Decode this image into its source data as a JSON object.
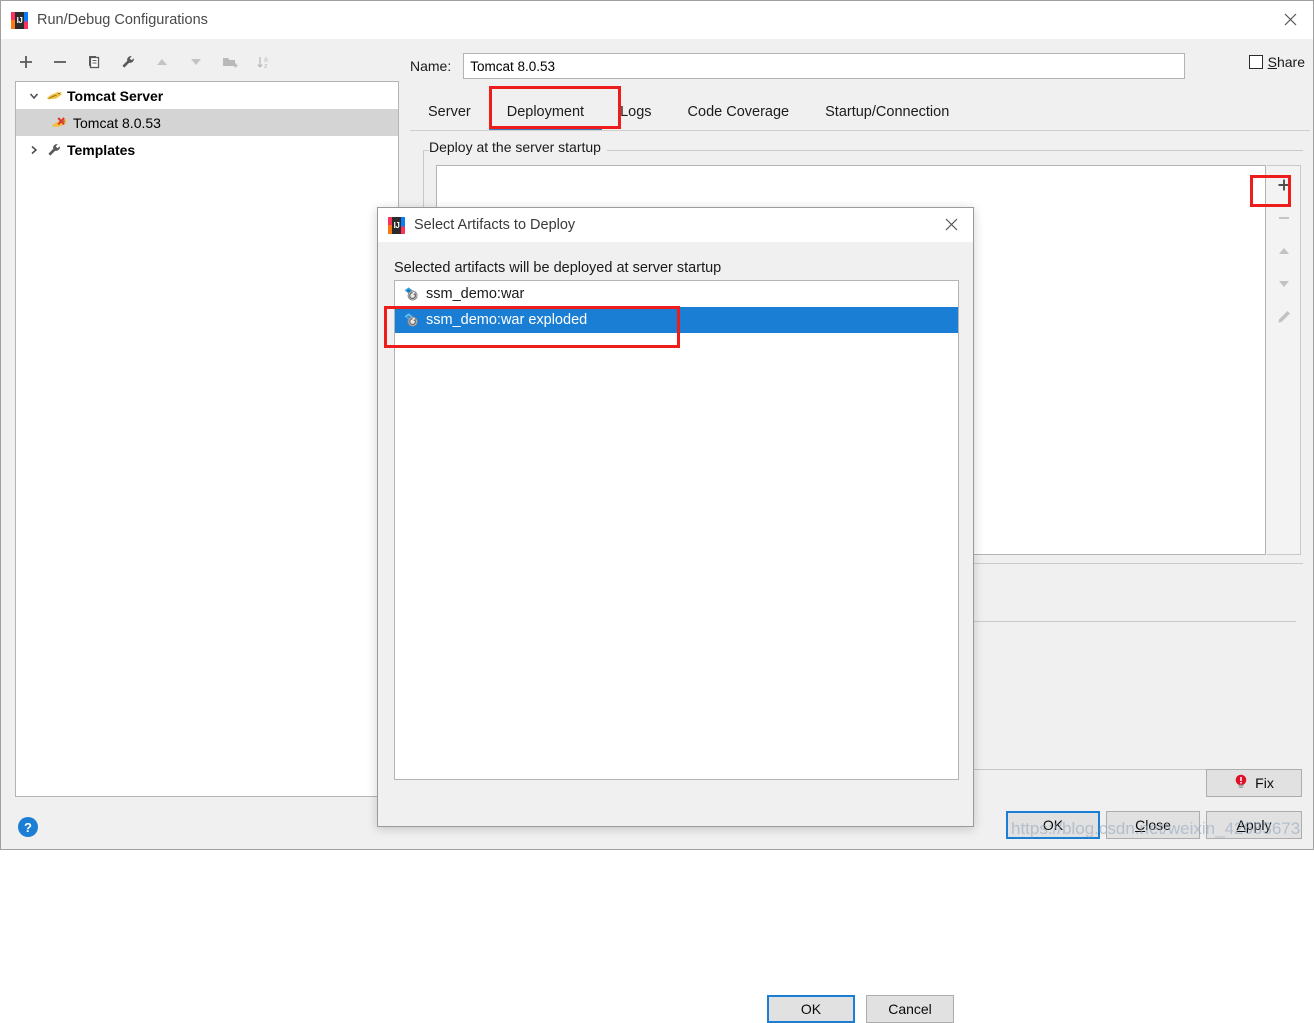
{
  "window": {
    "title": "Run/Debug Configurations",
    "logo_icon": "intellij-idea-logo",
    "logo_text": "IJ",
    "close_icon": "close-icon"
  },
  "toolbar": {
    "buttons": [
      {
        "name": "add-configuration-button",
        "icon": "plus-icon",
        "enabled": true
      },
      {
        "name": "remove-configuration-button",
        "icon": "minus-icon",
        "enabled": true
      },
      {
        "name": "copy-configuration-button",
        "icon": "copy-icon",
        "enabled": true
      },
      {
        "name": "edit-templates-button",
        "icon": "wrench-icon",
        "enabled": true
      },
      {
        "name": "move-up-button",
        "icon": "arrow-up-icon",
        "enabled": false
      },
      {
        "name": "move-down-button",
        "icon": "arrow-down-icon",
        "enabled": false
      },
      {
        "name": "create-folder-button",
        "icon": "folder-add-icon",
        "enabled": false
      },
      {
        "name": "sort-configurations-button",
        "icon": "sort-az-icon",
        "enabled": false
      }
    ]
  },
  "tree": {
    "items": [
      {
        "label": "Tomcat Server",
        "icon": "tomcat-icon",
        "level": 0,
        "expanded": true,
        "arrow": "chevron-down-icon",
        "selected": false,
        "error": false
      },
      {
        "label": "Tomcat 8.0.53",
        "icon": "tomcat-error-icon",
        "level": 1,
        "expanded": null,
        "arrow": "",
        "selected": true,
        "error": true
      },
      {
        "label": "Templates",
        "icon": "wrench-icon",
        "level": 0,
        "expanded": false,
        "arrow": "chevron-right-icon",
        "selected": false,
        "error": false
      }
    ]
  },
  "help": {
    "label": "?",
    "icon": "help-icon"
  },
  "name_field": {
    "label": "Name:",
    "value": "Tomcat 8.0.53",
    "placeholder": "Name"
  },
  "share": {
    "label_prefix": "",
    "label_mnemonic": "S",
    "label_rest": "hare",
    "checked": false
  },
  "tabs": [
    {
      "label": "Server",
      "active": false
    },
    {
      "label": "Deployment",
      "active": true
    },
    {
      "label": "Logs",
      "active": false
    },
    {
      "label": "Code Coverage",
      "active": false
    },
    {
      "label": "Startup/Connection",
      "active": false
    }
  ],
  "deploy_group": {
    "title": "Deploy at the server startup",
    "side_buttons": [
      {
        "name": "add-artifact-button",
        "icon": "plus-icon",
        "enabled": true
      },
      {
        "name": "remove-artifact-button",
        "icon": "minus-icon",
        "enabled": false
      },
      {
        "name": "move-artifact-up-button",
        "icon": "arrow-up-icon",
        "enabled": false
      },
      {
        "name": "move-artifact-down-button",
        "icon": "arrow-down-icon",
        "enabled": false
      },
      {
        "name": "edit-artifact-button",
        "icon": "pencil-icon",
        "enabled": false
      }
    ],
    "rows": []
  },
  "bottom_buttons": {
    "fix": {
      "label": "Fix",
      "icon": "error-bulb-icon"
    },
    "ok": {
      "label": "OK",
      "focused": true
    },
    "close": {
      "label_prefix": "",
      "label_mnemonic": "C",
      "label_rest": "lose"
    },
    "apply": {
      "label_prefix": "",
      "label_mnemonic": "A",
      "label_rest": "pply"
    }
  },
  "artifacts_dialog": {
    "title": "Select Artifacts to Deploy",
    "logo_icon": "intellij-idea-logo",
    "logo_text": "IJ",
    "close_icon": "close-icon",
    "hint": "Selected artifacts will be deployed at server startup",
    "items": [
      {
        "label": "ssm_demo:war",
        "icon": "artifact-icon",
        "selected": false
      },
      {
        "label": "ssm_demo:war exploded",
        "icon": "artifact-icon",
        "selected": true
      }
    ],
    "ok_label": "OK",
    "cancel_label": "Cancel"
  },
  "annotations": {
    "color": "#ef1c1c",
    "boxes": [
      "deployment-tab",
      "add-artifact-button",
      "selected-artifact-row"
    ]
  },
  "watermark": {
    "text": "https://blog.csdn.net/weixin_42663673"
  }
}
